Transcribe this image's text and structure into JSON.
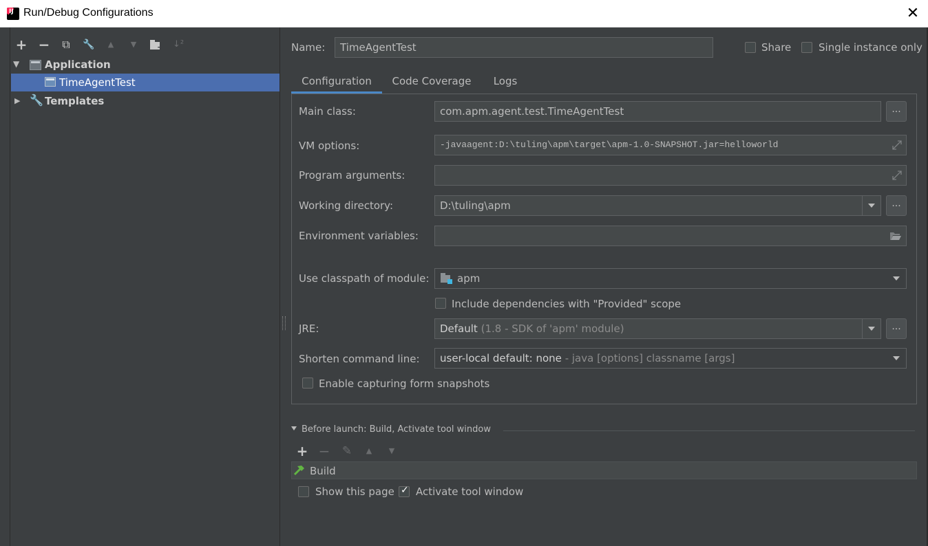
{
  "window": {
    "title": "Run/Debug Configurations",
    "close_symbol": "✕"
  },
  "toolbar": {
    "add": "+",
    "remove": "−",
    "copy": "⧉",
    "edit": "🔧",
    "up": "▲",
    "down": "▼",
    "folder": "▬",
    "sort": "↓²"
  },
  "tree": {
    "application_label": "Application",
    "child_label": "TimeAgentTest",
    "templates_label": "Templates",
    "expanded_arrow": "▼",
    "collapsed_arrow": "▶"
  },
  "header": {
    "name_label": "Name:",
    "name_value": "TimeAgentTest",
    "share_label": "Share",
    "single_instance_label": "Single instance only"
  },
  "tabs": [
    {
      "label": "Configuration"
    },
    {
      "label": "Code Coverage"
    },
    {
      "label": "Logs"
    }
  ],
  "config": {
    "main_class_label": "Main class:",
    "main_class_value": "com.apm.agent.test.TimeAgentTest",
    "vm_options_label": "VM options:",
    "vm_options_value": "-javaagent:D:\\tuling\\apm\\target\\apm-1.0-SNAPSHOT.jar=helloworld",
    "program_args_label": "Program arguments:",
    "program_args_value": "",
    "working_dir_label": "Working directory:",
    "working_dir_value": "D:\\tuling\\apm",
    "env_vars_label": "Environment variables:",
    "env_vars_value": "",
    "classpath_label": "Use classpath of module:",
    "classpath_value": "apm",
    "include_deps_label": "Include dependencies with \"Provided\" scope",
    "jre_label": "JRE:",
    "jre_value_main": "Default",
    "jre_value_hint": "(1.8 - SDK of 'apm' module)",
    "shorten_label": "Shorten command line:",
    "shorten_value_main": "user-local default: none",
    "shorten_value_hint": " - java [options] classname [args]",
    "snapshots_label": "Enable capturing form snapshots",
    "browse_symbol": "..."
  },
  "before_launch": {
    "header": "Before launch: Build, Activate tool window",
    "toolbar": {
      "add": "+",
      "remove": "−",
      "edit": "✎",
      "up": "▲",
      "down": "▼"
    },
    "build_label": "Build",
    "show_page_label": "Show this page",
    "activate_label": "Activate tool window",
    "show_page_checked": false,
    "activate_checked": true
  },
  "colors": {
    "background": "#3c3f41",
    "selection": "#4b6eaf",
    "field": "#45494a",
    "border": "#5e6163",
    "accent": "#4a88c7"
  }
}
